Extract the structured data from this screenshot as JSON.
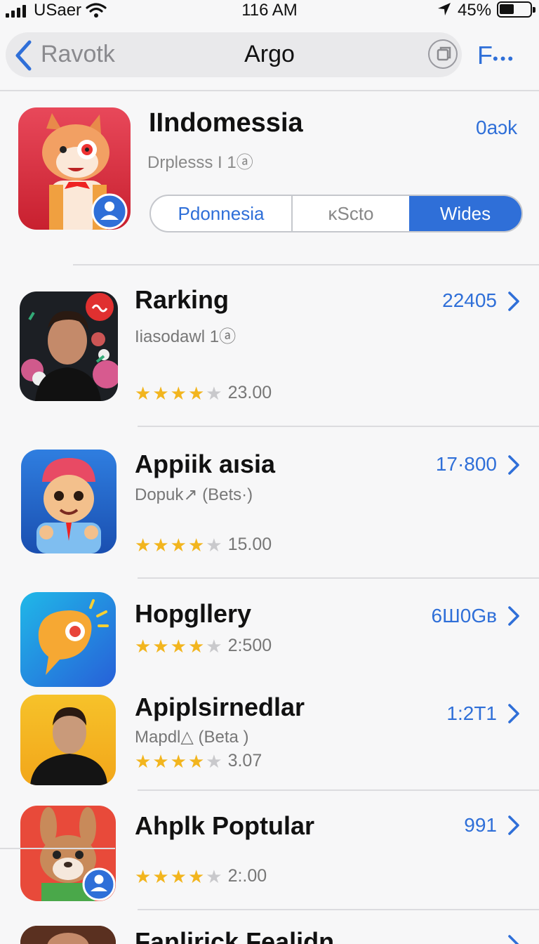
{
  "status": {
    "carrier": "USaer",
    "time": "116 AM",
    "battery": "45%"
  },
  "nav": {
    "back_label": "Ravotk",
    "title": "Argo",
    "more_label": "F"
  },
  "header": {
    "title": "IIndomessia",
    "subtitle": "Drplesss I 1ⓐ",
    "link": "0aɔk",
    "segments": [
      "Pdonnesia",
      "ᴋScto",
      "Wides"
    ],
    "selected_segment": "Wides"
  },
  "rows": [
    {
      "title": "Rarking",
      "subtitle": "Iiasodawl 1ⓐ",
      "rating_stars": 3.5,
      "rating_text": "23.00",
      "value": "22405"
    },
    {
      "title": "Appiik aısia",
      "subtitle": "Dopuk↗ (Bets·)",
      "rating_stars": 3.5,
      "rating_text": "15.00",
      "value": "17·800"
    },
    {
      "title": "Hopgllery",
      "subtitle": "",
      "rating_stars": 3.5,
      "rating_text": "2:500",
      "value": "6Ш0Gв"
    },
    {
      "title": "Apiplsirnedlar",
      "subtitle": "Mapdl△ (Beta )",
      "rating_stars": 3.5,
      "rating_text": "3.07",
      "value": "1:2T1"
    },
    {
      "title": "Ahplk Poptular",
      "subtitle": "",
      "rating_stars": 3.5,
      "rating_text": "2:.00",
      "value": "991"
    },
    {
      "title": "Fanlirick Fealidn",
      "subtitle": "",
      "rating_stars": 0,
      "rating_text": "",
      "value": ""
    }
  ],
  "colors": {
    "accent": "#2f6fd8",
    "star": "#f2b51e",
    "star_off": "#c9c9cc"
  }
}
